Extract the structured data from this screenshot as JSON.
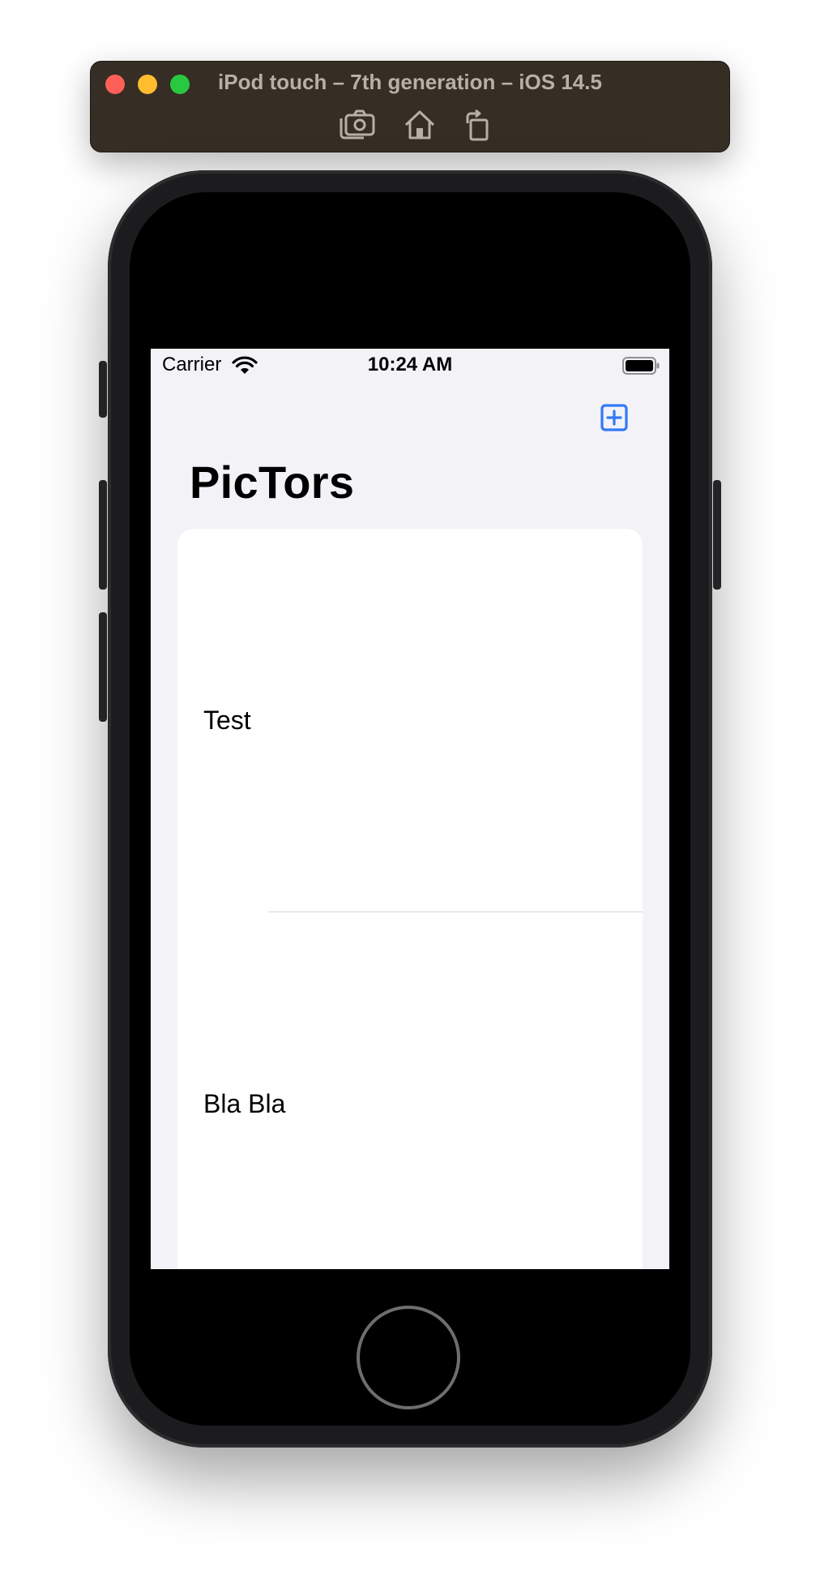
{
  "window": {
    "title": "iPod touch – 7th generation – iOS 14.5",
    "toolbar": {
      "screenshot_icon": "camera-icon",
      "home_icon": "home-icon",
      "rotate_icon": "rotate-icon"
    },
    "traffic_lights": [
      "#fe5f57",
      "#febc2e",
      "#28c840"
    ]
  },
  "status_bar": {
    "carrier": "Carrier",
    "time": "10:24 AM",
    "wifi_icon": "wifi-icon",
    "battery_icon": "battery-icon"
  },
  "nav": {
    "title": "PicTors",
    "add_icon": "plus-square-icon",
    "accent_color": "#3478f6"
  },
  "list": {
    "items": [
      {
        "label": "Test"
      },
      {
        "label": "Bla Bla"
      }
    ]
  }
}
